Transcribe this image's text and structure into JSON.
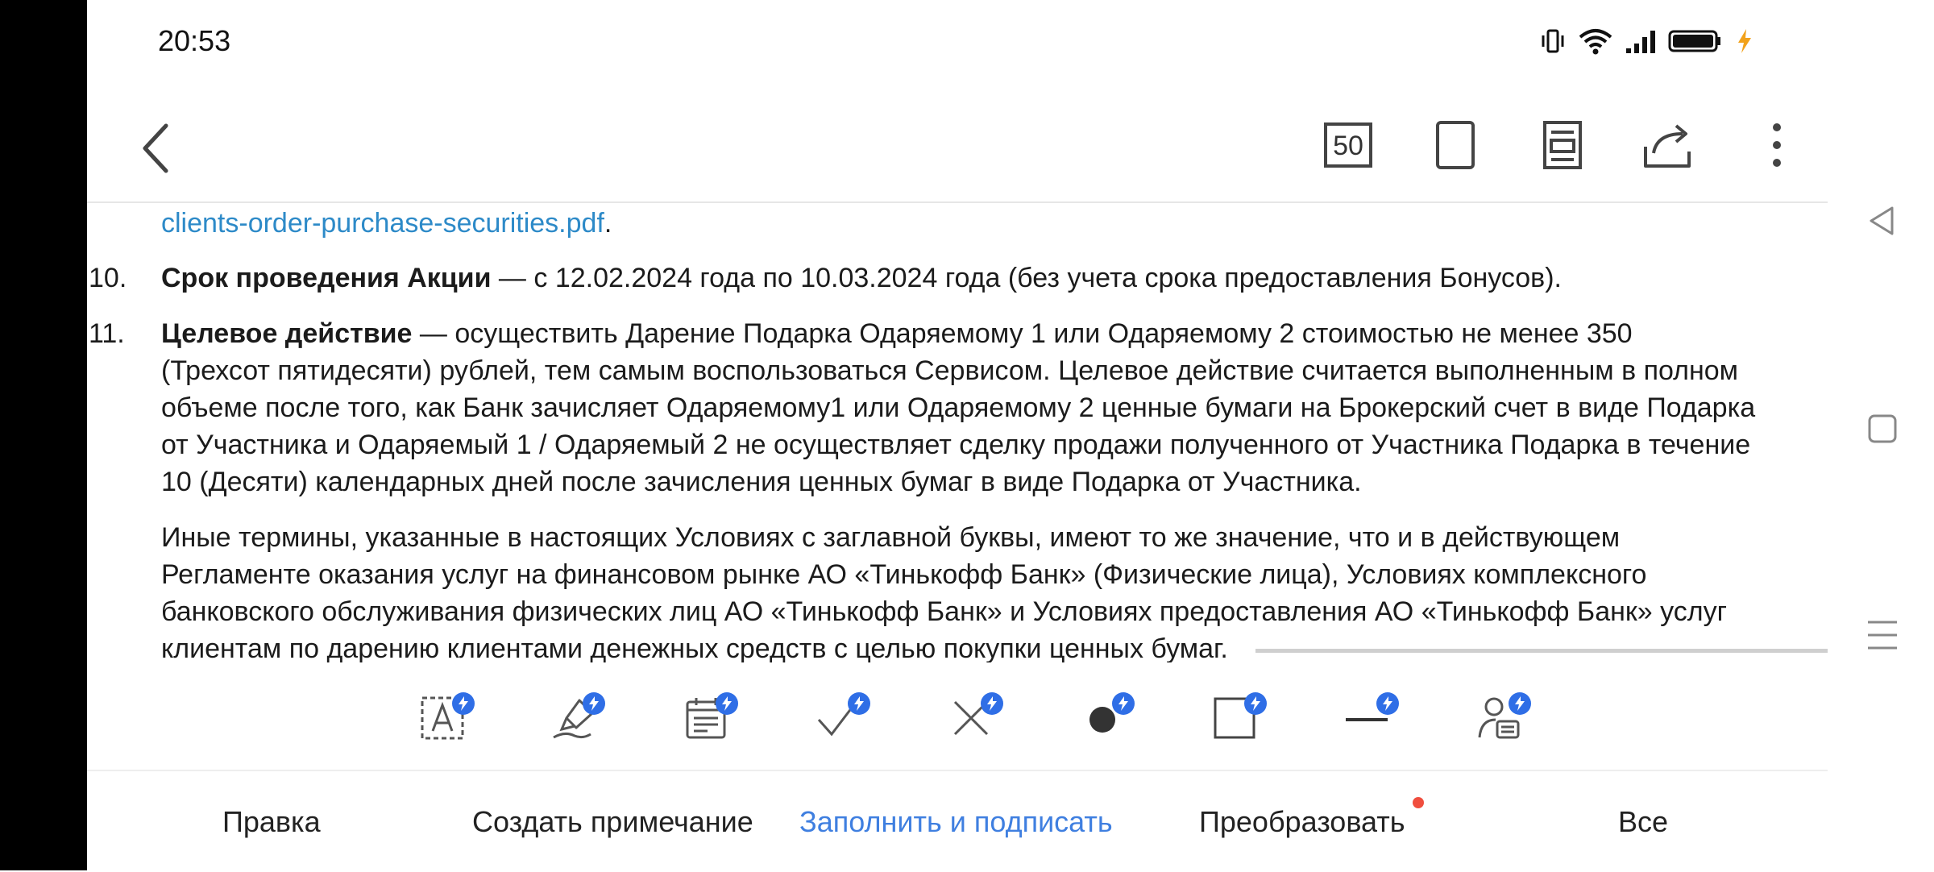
{
  "status": {
    "time": "20:53"
  },
  "toolbar": {
    "zoom": "50"
  },
  "document": {
    "link_text": "clients-order-purchase-securities.pdf",
    "link_suffix": ".",
    "item10": {
      "number": "10.",
      "term": "Срок проведения Акции",
      "text": " — с 12.02.2024 года по 10.03.2024 года (без учета срока предоставления Бонусов)."
    },
    "item11": {
      "number": "11.",
      "term": "Целевое действие",
      "text1": " — осуществить Дарение Подарка Одаряемому 1 или Одаряемому 2 стоимостью не менее 350",
      "lines": [
        "(Трехсот пятидесяти) рублей, тем самым воспользоваться Сервисом. Целевое действие считается выполненным в полном",
        "объеме после того, как Банк зачисляет Одаряемому1 или Одаряемому 2 ценные бумаги на Брокерский счет в виде Подарка",
        "от Участника и Одаряемый 1 / Одаряемый 2 не осуществляет сделку продажи полученного от Участника Подарка в течение",
        "10 (Десяти) календарных дней после зачисления ценных бумаг в виде Подарка от Участника."
      ]
    },
    "paragraph": [
      "Иные термины, указанные в настоящих Условиях с заглавной буквы, имеют то же значение, что и в действующем",
      "Регламенте оказания услуг на финансовом рынке АО «Тинькофф Банк» (Физические лица), Условиях комплексного",
      "банковского обслуживания физических лиц АО «Тинькофф Банк» и Условиях предоставления АО «Тинькофф Банк» услуг",
      "клиентам по дарению клиентами денежных средств с целью покупки ценных бумаг."
    ]
  },
  "tabs": [
    {
      "label": "Правка"
    },
    {
      "label": "Создать примечание"
    },
    {
      "label": "Заполнить и подписать"
    },
    {
      "label": "Преобразовать"
    },
    {
      "label": "Все"
    }
  ],
  "colors": {
    "accent": "#3f7fe0",
    "link": "#2d8ac8",
    "badge": "#2f6ee6",
    "notification": "#f04e3e"
  }
}
